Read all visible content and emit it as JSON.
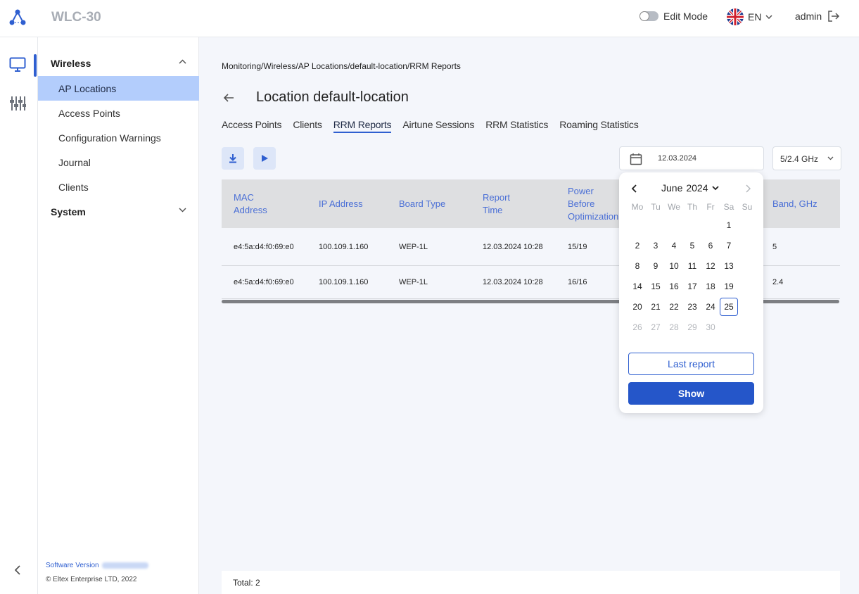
{
  "header": {
    "app_title": "WLC-30",
    "edit_mode_label": "Edit Mode",
    "language": "EN",
    "user": "admin"
  },
  "sidebar": {
    "groups": [
      {
        "label": "Wireless",
        "expanded": true,
        "items": [
          {
            "label": "AP Locations",
            "active": true
          },
          {
            "label": "Access Points"
          },
          {
            "label": "Configuration Warnings"
          },
          {
            "label": "Journal"
          },
          {
            "label": "Clients"
          }
        ]
      },
      {
        "label": "System",
        "expanded": false
      }
    ],
    "software_version_label": "Software Version",
    "copyright": "© Eltex Enterprise LTD, 2022"
  },
  "main": {
    "breadcrumb": "Monitoring/Wireless/AP Locations/default-location/RRM Reports",
    "title": "Location default-location",
    "tabs": [
      "Access Points",
      "Clients",
      "RRM Reports",
      "Airtune Sessions",
      "RRM Statistics",
      "Roaming Statistics"
    ],
    "active_tab": "RRM Reports",
    "date_value": "12.03.2024",
    "band_select": "5/2.4 GHz",
    "table": {
      "headers": [
        "MAC\nAddress",
        "IP Address",
        "Board Type",
        "Report\nTime",
        "Power Before\nOptimization",
        "Band, GHz"
      ],
      "rows": [
        [
          "e4:5a:d4:f0:69:e0",
          "100.109.1.160",
          "WEP-1L",
          "12.03.2024 10:28",
          "15/19",
          "5"
        ],
        [
          "e4:5a:d4:f0:69:e0",
          "100.109.1.160",
          "WEP-1L",
          "12.03.2024 10:28",
          "16/16",
          "2.4"
        ]
      ]
    },
    "total": "Total: 2"
  },
  "calendar": {
    "month": "June",
    "year": "2024",
    "weekdays": [
      "Mo",
      "Tu",
      "We",
      "Th",
      "Fr",
      "Sa",
      "Su"
    ],
    "weeks": [
      [
        "",
        "",
        "",
        "",
        "",
        "1",
        ""
      ],
      [
        "2",
        "3",
        "4",
        "5",
        "6",
        "7",
        ""
      ],
      [
        "8",
        "9",
        "10",
        "11",
        "12",
        "13",
        ""
      ],
      [
        "14",
        "15",
        "16",
        "17",
        "18",
        "19",
        ""
      ],
      [
        "20",
        "21",
        "22",
        "23",
        "24",
        "25",
        ""
      ],
      [
        "26",
        "27",
        "28",
        "29",
        "30",
        "",
        ""
      ]
    ],
    "selected_day": "25",
    "last_report_label": "Last report",
    "show_label": "Show"
  },
  "colors": {
    "accent": "#2f5fd0",
    "active_sidebar": "#b3cdfc",
    "table_header_bg": "#dedfe1",
    "header_text": "#4a6fd6"
  }
}
